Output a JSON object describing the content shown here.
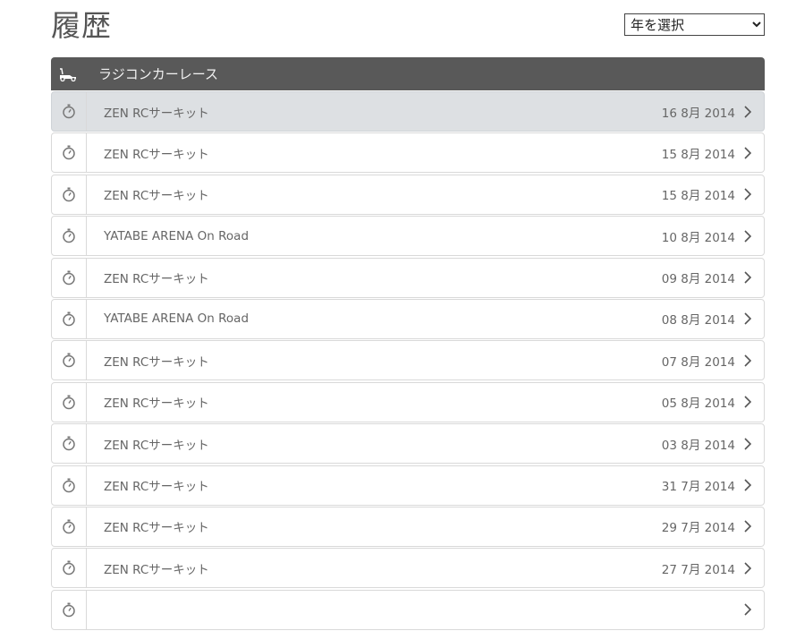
{
  "page": {
    "title": "履歴"
  },
  "year_selector": {
    "selected": "年を選択"
  },
  "category": {
    "icon": "rc-car-icon",
    "title": "ラジコンカーレース"
  },
  "history": [
    {
      "venue": "ZEN RCサーキット",
      "date": "16 8月 2014",
      "icon": "stopwatch-icon",
      "selected": true
    },
    {
      "venue": "ZEN RCサーキット",
      "date": "15 8月 2014",
      "icon": "stopwatch-icon"
    },
    {
      "venue": "ZEN RCサーキット",
      "date": "15 8月 2014",
      "icon": "stopwatch-icon"
    },
    {
      "venue": "YATABE ARENA On Road",
      "date": "10 8月 2014",
      "icon": "stopwatch-icon"
    },
    {
      "venue": "ZEN RCサーキット",
      "date": "09 8月 2014",
      "icon": "stopwatch-icon"
    },
    {
      "venue": "YATABE ARENA On Road",
      "date": "08 8月 2014",
      "icon": "stopwatch-icon"
    },
    {
      "venue": "ZEN RCサーキット",
      "date": "07 8月 2014",
      "icon": "stopwatch-icon"
    },
    {
      "venue": "ZEN RCサーキット",
      "date": "05 8月 2014",
      "icon": "stopwatch-icon"
    },
    {
      "venue": "ZEN RCサーキット",
      "date": "03 8月 2014",
      "icon": "stopwatch-icon"
    },
    {
      "venue": "ZEN RCサーキット",
      "date": "31 7月 2014",
      "icon": "stopwatch-icon"
    },
    {
      "venue": "ZEN RCサーキット",
      "date": "29 7月 2014",
      "icon": "stopwatch-icon"
    },
    {
      "venue": "ZEN RCサーキット",
      "date": "27 7月 2014",
      "icon": "stopwatch-icon"
    },
    {
      "venue": "",
      "date": "",
      "icon": "stopwatch-icon"
    }
  ],
  "colors": {
    "header_bg": "#595959",
    "selected_row_bg": "#dde0e3",
    "border": "#d9d9d9",
    "text": "#666666"
  }
}
